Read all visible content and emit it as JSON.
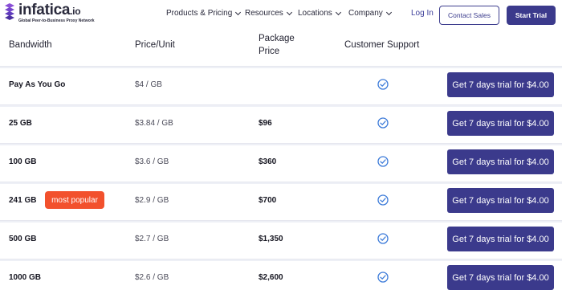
{
  "brand": {
    "name": "infatica",
    "tld": ".io",
    "tagline": "Global Peer-to-Business Proxy Network",
    "accent": "#3b3a8c",
    "logo_colors": [
      "#8a4fd6",
      "#6b3fc2",
      "#4b2fa0"
    ]
  },
  "nav": {
    "menu": [
      {
        "label": "Products & Pricing",
        "icon": "chevron-down-icon"
      },
      {
        "label": "Resources",
        "icon": "chevron-down-icon"
      },
      {
        "label": "Locations",
        "icon": "chevron-down-icon"
      },
      {
        "label": "Company",
        "icon": "chevron-down-icon"
      }
    ],
    "login_label": "Log In",
    "contact_label": "Contact Sales",
    "trial_label": "Start Trial"
  },
  "table": {
    "headers": {
      "bandwidth": "Bandwidth",
      "price_unit": "Price/Unit",
      "package_price": "Package Price",
      "support": "Customer Support"
    },
    "badge_color": "#f2512d",
    "check_color": "#3b7ad9",
    "rows": [
      {
        "bandwidth": "Pay As You Go",
        "price_unit": "$4 / GB",
        "package_price": "",
        "support": "check-circle-icon",
        "cta": "Get 7 days trial for $4.00",
        "badge": ""
      },
      {
        "bandwidth": "25 GB",
        "price_unit": "$3.84 / GB",
        "package_price": "$96",
        "support": "check-circle-icon",
        "cta": "Get 7 days trial for $4.00",
        "badge": ""
      },
      {
        "bandwidth": "100 GB",
        "price_unit": "$3.6 / GB",
        "package_price": "$360",
        "support": "check-circle-icon",
        "cta": "Get 7 days trial for $4.00",
        "badge": ""
      },
      {
        "bandwidth": "241 GB",
        "price_unit": "$2.9 / GB",
        "package_price": "$700",
        "support": "check-circle-icon",
        "cta": "Get 7 days trial for $4.00",
        "badge": "most popular"
      },
      {
        "bandwidth": "500 GB",
        "price_unit": "$2.7 / GB",
        "package_price": "$1,350",
        "support": "check-circle-icon",
        "cta": "Get 7 days trial for $4.00",
        "badge": ""
      },
      {
        "bandwidth": "1000 GB",
        "price_unit": "$2.6 / GB",
        "package_price": "$2,600",
        "support": "check-circle-icon",
        "cta": "Get 7 days trial for $4.00",
        "badge": ""
      }
    ]
  }
}
